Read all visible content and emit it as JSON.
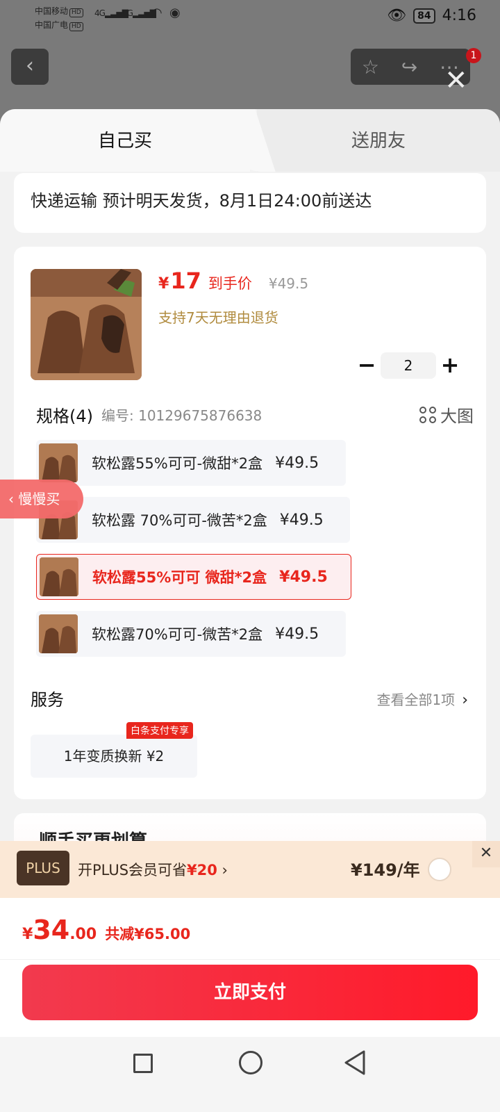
{
  "status_bar": {
    "carrier_1": "中国移动",
    "carrier_2": "中国广电",
    "hd": "HD",
    "signal_1": "4G",
    "signal_2": "4G",
    "battery": "84",
    "time": "4:16"
  },
  "top": {
    "notification_count": "1"
  },
  "tabs": {
    "self_buy": "自己买",
    "gift": "送朋友"
  },
  "delivery": {
    "text": "快递运输 预计明天发货，8月1日24:00前送达"
  },
  "product": {
    "price_symbol": "¥",
    "price": "17",
    "price_label": "到手价",
    "original_price": "¥49.5",
    "return_note": "支持7天无理由退货",
    "quantity": "2",
    "minus": "−",
    "plus": "+"
  },
  "spec": {
    "title": "规格(4)",
    "sku": "编号: 10129675876638",
    "big_pic": "大图",
    "options": [
      {
        "label": "软松露55%可可-微甜*2盒",
        "price": "¥49.5",
        "selected": false
      },
      {
        "label": "软松露 70%可可-微苦*2盒",
        "price": "¥49.5",
        "selected": false
      },
      {
        "label": "软松露55%可可 微甜*2盒",
        "price": "¥49.5",
        "selected": true
      },
      {
        "label": "软松露70%可可-微苦*2盒",
        "price": "¥49.5",
        "selected": false
      }
    ]
  },
  "slow_buy": "慢慢买",
  "service": {
    "title": "服务",
    "view_all": "查看全部1项",
    "badge": "白条支付专享",
    "item": "1年变质换新 ¥2"
  },
  "next_section": {
    "title": "顺手买更划算"
  },
  "plus": {
    "logo": "PLUS",
    "text_prefix": "开PLUS会员可省",
    "save": "¥20",
    "price": "¥149/年"
  },
  "pay": {
    "symbol": "¥",
    "amount_int": "34",
    "amount_dec": ".00",
    "reduce": "共减¥65.00",
    "button": "立即支付"
  }
}
